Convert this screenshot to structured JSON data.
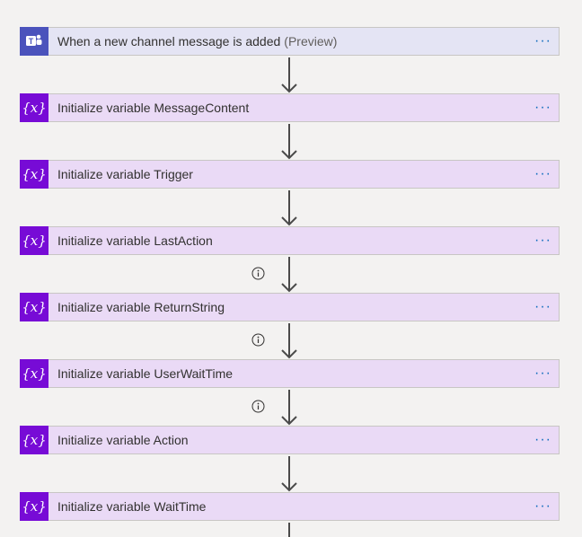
{
  "trigger": {
    "title": "When a new channel message is added",
    "preview": "(Preview)",
    "icon": "teams-icon"
  },
  "variable_icon_text": "{x}",
  "more_glyph": "···",
  "steps": [
    {
      "title": "Initialize variable MessageContent"
    },
    {
      "title": "Initialize variable Trigger"
    },
    {
      "title": "Initialize variable LastAction"
    },
    {
      "title": "Initialize variable ReturnString"
    },
    {
      "title": "Initialize variable UserWaitTime"
    },
    {
      "title": "Initialize variable Action"
    },
    {
      "title": "Initialize variable WaitTime"
    }
  ],
  "colors": {
    "trigger_bg": "#e4e4f4",
    "trigger_icon_bg": "#4b53bc",
    "variable_bg": "#eadaf6",
    "variable_icon_bg": "#770bd6",
    "canvas_bg": "#f3f2f1",
    "more_color": "#0f6cbd"
  }
}
